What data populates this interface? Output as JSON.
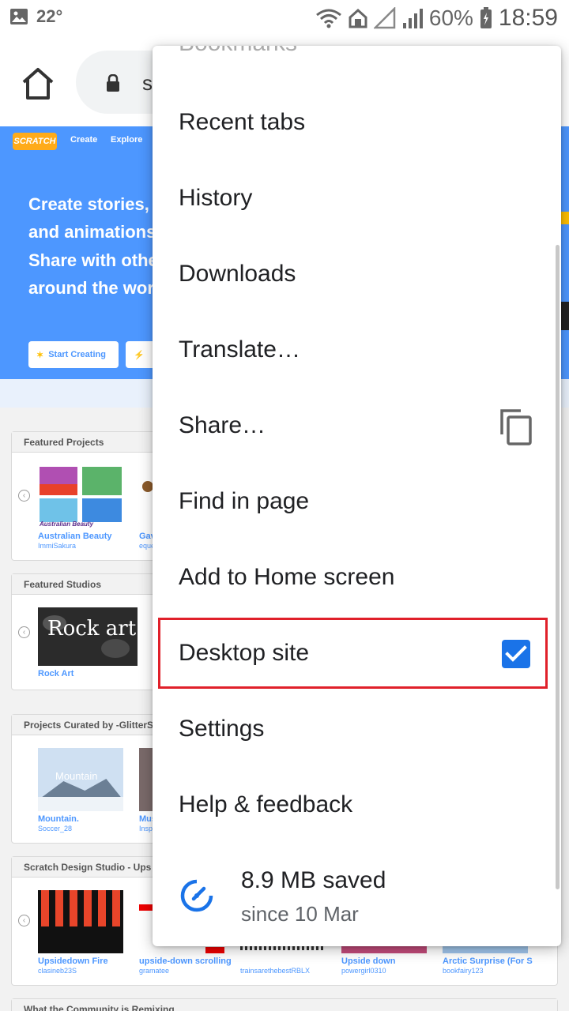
{
  "status_bar": {
    "temperature": "22°",
    "battery_percent": "60%",
    "time": "18:59"
  },
  "toolbar": {
    "url_partial": "s"
  },
  "webpage": {
    "logo_text": "SCRATCH",
    "nav": [
      "Create",
      "Explore"
    ],
    "hero_lines": [
      "Create stories,",
      "and animations",
      "Share with othe",
      "around the wor"
    ],
    "hero_buttons": [
      "Start Creating",
      ""
    ],
    "sections": [
      {
        "title": "Featured Projects",
        "items": [
          {
            "name": "Australian Beauty",
            "author": "ImmiSakura",
            "thumb_text": "Australian Beauty"
          },
          {
            "name": "Gav",
            "author": "eque",
            "thumb_text": ""
          }
        ]
      },
      {
        "title": "Featured Studios",
        "items": [
          {
            "name": "Rock Art",
            "author": "",
            "thumb_text": "Rock art"
          }
        ]
      },
      {
        "title": "Projects Curated by -GlitterS",
        "items": [
          {
            "name": "Mountain.",
            "author": "Soccer_28",
            "thumb_text": "Mountain"
          },
          {
            "name": "Mus",
            "author": "Insp",
            "thumb_text": ""
          }
        ]
      },
      {
        "title": "Scratch Design Studio - Ups",
        "items": [
          {
            "name": "Upsidedown Fire",
            "author": "clasineb23S"
          },
          {
            "name": "upside-down scrolling",
            "author": "gramatee"
          },
          {
            "name": "",
            "author": "trainsarethebestRBLX"
          },
          {
            "name": "Upside down",
            "author": "powergirl0310"
          },
          {
            "name": "Arctic Surprise (For S",
            "author": "bookfairy123"
          }
        ]
      },
      {
        "title": "What the Community is Remixing",
        "items": []
      }
    ]
  },
  "menu": {
    "cut_top_item": "Bookmarks",
    "items": [
      {
        "label": "Recent tabs"
      },
      {
        "label": "History"
      },
      {
        "label": "Downloads"
      },
      {
        "label": "Translate…"
      },
      {
        "label": "Share…"
      },
      {
        "label": "Find in page"
      },
      {
        "label": "Add to Home screen"
      },
      {
        "label": "Desktop site"
      },
      {
        "label": "Settings"
      },
      {
        "label": "Help & feedback"
      }
    ],
    "desktop_site_checked": true,
    "data_saved": "8.9 MB saved",
    "data_saved_since": "since 10 Mar"
  },
  "colors": {
    "scratch_blue": "#4d97ff",
    "checkbox_blue": "#1a73e8",
    "highlight_red": "#e0202a",
    "text_dark": "#202124"
  }
}
